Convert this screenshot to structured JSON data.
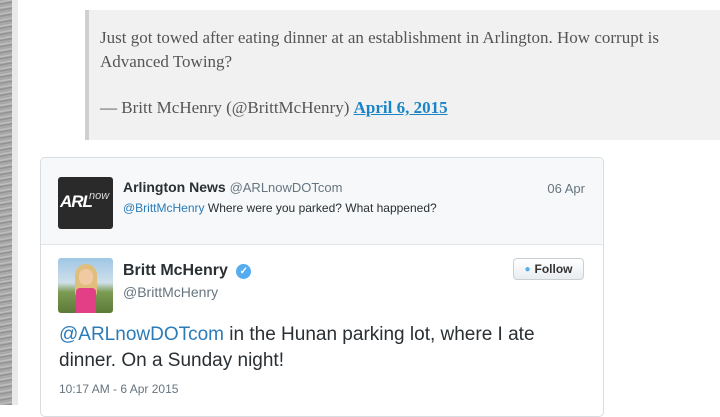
{
  "blockquote": {
    "text": "Just got towed after eating dinner at an establishment in Arlington. How corrupt is Advanced Towing?",
    "attribution": "— Britt McHenry (@BrittMcHenry)",
    "date_link": "April 6, 2015"
  },
  "reply_tweet": {
    "logo_text_main": "ARL",
    "logo_text_sub": "now",
    "name": "Arlington News",
    "handle": "@ARLnowDOTcom",
    "date": "06 Apr",
    "mention": "@BrittMcHenry",
    "text": " Where were you parked? What happened?"
  },
  "main_tweet": {
    "name": "Britt McHenry",
    "handle": "@BrittMcHenry",
    "follow_label": "Follow",
    "mention": "@ARLnowDOTcom",
    "text": " in the Hunan parking lot, where I ate dinner. On a Sunday night!",
    "timestamp": "10:17 AM - 6 Apr 2015"
  },
  "colors": {
    "link": "#1a84c7",
    "twitter_blue": "#55acee",
    "mention": "#2b7bb9"
  }
}
